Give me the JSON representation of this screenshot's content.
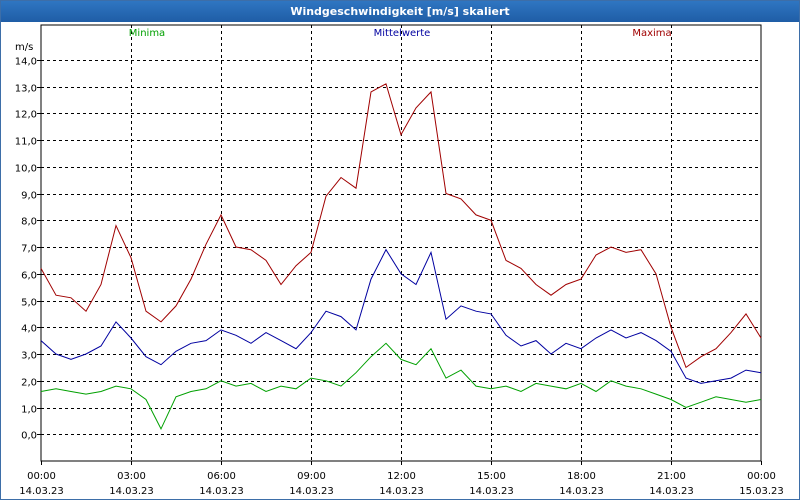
{
  "window": {
    "title": "Windgeschwindigkeit [m/s] skaliert"
  },
  "chart_data": {
    "type": "line",
    "title": "Windgeschwindigkeit [m/s] skaliert",
    "ylabel": "m/s",
    "xlabel": "",
    "ylim": [
      -1.0,
      15.3
    ],
    "xlim": [
      0,
      24
    ],
    "grid": true,
    "legend": "top",
    "y_ticks": [
      "0,0",
      "1,0",
      "2,0",
      "3,0",
      "4,0",
      "5,0",
      "6,0",
      "7,0",
      "8,0",
      "9,0",
      "10,0",
      "11,0",
      "12,0",
      "13,0",
      "14,0"
    ],
    "x_ticks": [
      {
        "time": "00:00",
        "date": "14.03.23"
      },
      {
        "time": "03:00",
        "date": "14.03.23"
      },
      {
        "time": "06:00",
        "date": "14.03.23"
      },
      {
        "time": "09:00",
        "date": "14.03.23"
      },
      {
        "time": "12:00",
        "date": "14.03.23"
      },
      {
        "time": "15:00",
        "date": "14.03.23"
      },
      {
        "time": "18:00",
        "date": "14.03.23"
      },
      {
        "time": "21:00",
        "date": "14.03.23"
      },
      {
        "time": "00:00",
        "date": "15.03.23"
      }
    ],
    "series": [
      {
        "name": "Minima",
        "color": "#00a000",
        "x": [
          0,
          0.5,
          1,
          1.5,
          2,
          2.5,
          3,
          3.5,
          4,
          4.5,
          5,
          5.5,
          6,
          6.5,
          7,
          7.5,
          8,
          8.5,
          9,
          9.5,
          10,
          10.5,
          11,
          11.5,
          12,
          12.5,
          13,
          13.5,
          14,
          14.5,
          15,
          15.5,
          16,
          16.5,
          17,
          17.5,
          18,
          18.5,
          19,
          19.5,
          20,
          20.5,
          21,
          21.5,
          22,
          22.5,
          23,
          23.5,
          24
        ],
        "values": [
          1.6,
          1.7,
          1.6,
          1.5,
          1.6,
          1.8,
          1.7,
          1.3,
          0.2,
          1.4,
          1.6,
          1.7,
          2.0,
          1.8,
          1.9,
          1.6,
          1.8,
          1.7,
          2.1,
          2.0,
          1.8,
          2.3,
          2.9,
          3.4,
          2.8,
          2.6,
          3.2,
          2.1,
          2.4,
          1.8,
          1.7,
          1.8,
          1.6,
          1.9,
          1.8,
          1.7,
          1.9,
          1.6,
          2.0,
          1.8,
          1.7,
          1.5,
          1.3,
          1.0,
          1.2,
          1.4,
          1.3,
          1.2,
          1.3
        ]
      },
      {
        "name": "Mittelwerte",
        "color": "#0000a0",
        "x": [
          0,
          0.5,
          1,
          1.5,
          2,
          2.5,
          3,
          3.5,
          4,
          4.5,
          5,
          5.5,
          6,
          6.5,
          7,
          7.5,
          8,
          8.5,
          9,
          9.5,
          10,
          10.5,
          11,
          11.5,
          12,
          12.5,
          13,
          13.5,
          14,
          14.5,
          15,
          15.5,
          16,
          16.5,
          17,
          17.5,
          18,
          18.5,
          19,
          19.5,
          20,
          20.5,
          21,
          21.5,
          22,
          22.5,
          23,
          23.5,
          24
        ],
        "values": [
          3.5,
          3.0,
          2.8,
          3.0,
          3.3,
          4.2,
          3.6,
          2.9,
          2.6,
          3.1,
          3.4,
          3.5,
          3.9,
          3.7,
          3.4,
          3.8,
          3.5,
          3.2,
          3.8,
          4.6,
          4.4,
          3.9,
          5.8,
          6.9,
          6.0,
          5.6,
          6.8,
          4.3,
          4.8,
          4.6,
          4.5,
          3.7,
          3.3,
          3.5,
          3.0,
          3.4,
          3.2,
          3.6,
          3.9,
          3.6,
          3.8,
          3.5,
          3.1,
          2.1,
          1.9,
          2.0,
          2.1,
          2.4,
          2.3
        ]
      },
      {
        "name": "Maxima",
        "color": "#a00000",
        "x": [
          0,
          0.5,
          1,
          1.5,
          2,
          2.5,
          3,
          3.5,
          4,
          4.5,
          5,
          5.5,
          6,
          6.5,
          7,
          7.5,
          8,
          8.5,
          9,
          9.5,
          10,
          10.5,
          11,
          11.5,
          12,
          12.5,
          13,
          13.5,
          14,
          14.5,
          15,
          15.5,
          16,
          16.5,
          17,
          17.5,
          18,
          18.5,
          19,
          19.5,
          20,
          20.5,
          21,
          21.5,
          22,
          22.5,
          23,
          23.5,
          24
        ],
        "values": [
          6.2,
          5.2,
          5.1,
          4.6,
          5.6,
          7.8,
          6.6,
          4.6,
          4.2,
          4.8,
          5.8,
          7.1,
          8.2,
          7.0,
          6.9,
          6.5,
          5.6,
          6.3,
          6.8,
          8.9,
          9.6,
          9.2,
          12.8,
          13.1,
          11.2,
          12.2,
          12.8,
          9.0,
          8.8,
          8.2,
          8.0,
          6.5,
          6.2,
          5.6,
          5.2,
          5.6,
          5.8,
          6.7,
          7.0,
          6.8,
          6.9,
          6.0,
          4.0,
          2.5,
          2.9,
          3.2,
          3.8,
          4.5,
          3.6
        ]
      }
    ]
  }
}
